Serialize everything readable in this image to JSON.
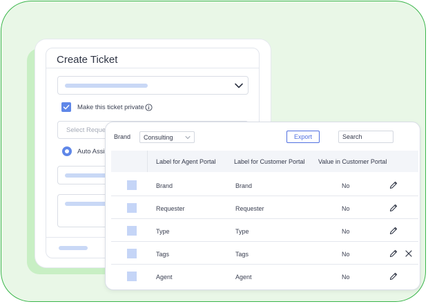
{
  "ticket_form": {
    "title": "Create Ticket",
    "private_label": "Make this ticket private",
    "select_placeholder": "Select Reque",
    "auto_label": "Auto Assig"
  },
  "table_panel": {
    "brand_label": "Brand",
    "brand_value": "Consulting",
    "export_label": "Export",
    "search_value": "Search",
    "columns": [
      "Label for Agent Portal",
      "Label for Customer Portal",
      "Value in Customer Portal"
    ],
    "rows": [
      {
        "agent_label": "Brand",
        "customer_label": "Brand",
        "value": "No"
      },
      {
        "agent_label": "Requester",
        "customer_label": "Requester",
        "value": "No"
      },
      {
        "agent_label": "Type",
        "customer_label": "Type",
        "value": "No"
      },
      {
        "agent_label": "Tags",
        "customer_label": "Tags",
        "value": "No"
      },
      {
        "agent_label": "Agent",
        "customer_label": "Agent",
        "value": "No"
      }
    ]
  },
  "icons": {
    "dropdown": "chevron-down-icon",
    "info": "info-icon",
    "edit": "pencil-icon",
    "remove": "close-icon"
  },
  "colors": {
    "accent": "#5f87e8",
    "export": "#4f6fe0",
    "background": "#e9f7e7",
    "border_green": "#39b54a"
  }
}
